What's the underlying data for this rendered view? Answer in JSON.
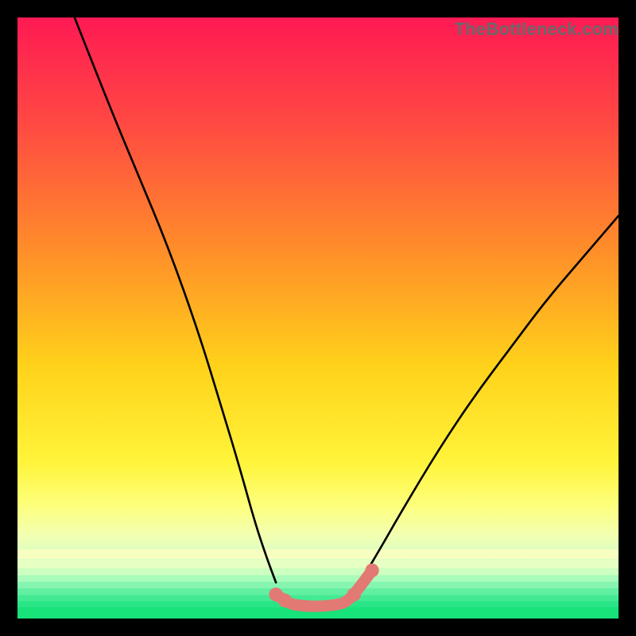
{
  "watermark": "TheBottleneck.com",
  "chart_data": {
    "type": "line",
    "title": "",
    "xlabel": "",
    "ylabel": "",
    "xlim": [
      0,
      100
    ],
    "ylim": [
      0,
      100
    ],
    "left_curve": [
      {
        "x": 9.5,
        "y": 100
      },
      {
        "x": 15,
        "y": 86
      },
      {
        "x": 20,
        "y": 74
      },
      {
        "x": 25,
        "y": 62
      },
      {
        "x": 30,
        "y": 48
      },
      {
        "x": 34,
        "y": 35
      },
      {
        "x": 37,
        "y": 25
      },
      {
        "x": 39.5,
        "y": 16
      },
      {
        "x": 41.5,
        "y": 10
      },
      {
        "x": 43,
        "y": 6
      }
    ],
    "right_curve": [
      {
        "x": 57,
        "y": 6
      },
      {
        "x": 60,
        "y": 11
      },
      {
        "x": 64,
        "y": 18
      },
      {
        "x": 70,
        "y": 28
      },
      {
        "x": 76,
        "y": 37
      },
      {
        "x": 82,
        "y": 45
      },
      {
        "x": 88,
        "y": 53
      },
      {
        "x": 94,
        "y": 60
      },
      {
        "x": 100,
        "y": 67
      }
    ],
    "bottom_segment": [
      {
        "x": 43,
        "y": 4,
        "cap": true
      },
      {
        "x": 44.5,
        "y": 3,
        "cap": true
      },
      {
        "x": 45.5,
        "y": 2.4,
        "cap": false
      },
      {
        "x": 47.5,
        "y": 2.1,
        "cap": false
      },
      {
        "x": 50,
        "y": 2.0,
        "cap": false
      },
      {
        "x": 52.5,
        "y": 2.2,
        "cap": false
      },
      {
        "x": 54.5,
        "y": 2.6,
        "cap": false
      },
      {
        "x": 56,
        "y": 4,
        "cap": true
      },
      {
        "x": 59,
        "y": 8,
        "cap": true
      }
    ],
    "gradient_stops": [
      {
        "offset": 0,
        "color": "#ff1a54"
      },
      {
        "offset": 18,
        "color": "#ff4a42"
      },
      {
        "offset": 38,
        "color": "#ff8b2a"
      },
      {
        "offset": 58,
        "color": "#ffd21a"
      },
      {
        "offset": 74,
        "color": "#fff43a"
      },
      {
        "offset": 81,
        "color": "#fdff7a"
      },
      {
        "offset": 86,
        "color": "#f3ffb0"
      },
      {
        "offset": 90,
        "color": "#d6ffc5"
      },
      {
        "offset": 94,
        "color": "#8cf7b0"
      },
      {
        "offset": 100,
        "color": "#18e27a"
      }
    ],
    "bottom_bands": [
      {
        "y": 88.5,
        "h": 1.6,
        "color": "#f7ffc0"
      },
      {
        "y": 90.2,
        "h": 1.4,
        "color": "#e6ffc2"
      },
      {
        "y": 91.6,
        "h": 1.2,
        "color": "#ccffc0"
      },
      {
        "y": 92.8,
        "h": 1.1,
        "color": "#a8fbba"
      },
      {
        "y": 93.9,
        "h": 1.1,
        "color": "#85f5b0"
      },
      {
        "y": 95.0,
        "h": 1.1,
        "color": "#62efa2"
      },
      {
        "y": 96.1,
        "h": 1.0,
        "color": "#43ea93"
      },
      {
        "y": 97.1,
        "h": 1.0,
        "color": "#2ae587"
      },
      {
        "y": 98.1,
        "h": 1.9,
        "color": "#18e27a"
      }
    ],
    "marker_color": "#e37973",
    "curve_color": "#000000"
  }
}
